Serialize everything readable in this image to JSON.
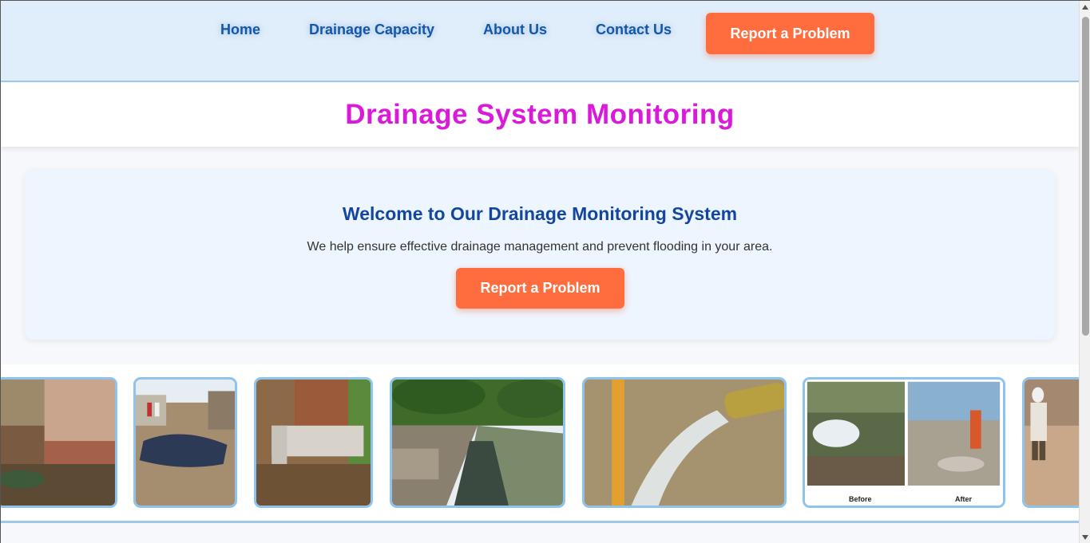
{
  "nav": {
    "links": [
      "Home",
      "Drainage Capacity",
      "About Us",
      "Contact Us"
    ],
    "report_button": "Report a Problem"
  },
  "header": {
    "title": "Drainage System Monitoring"
  },
  "welcome": {
    "heading": "Welcome to Our Drainage Monitoring System",
    "text": "We help ensure effective drainage management and prevent flooding in your area.",
    "button": "Report a Problem"
  },
  "gallery": {
    "before_label": "Before",
    "after_label": "After"
  },
  "colors": {
    "accent_orange": "#ff6d3f",
    "nav_link": "#1457a8",
    "title_magenta": "#d91ad9",
    "heading_blue": "#1446a0",
    "thumb_border": "#8ec3ee"
  }
}
